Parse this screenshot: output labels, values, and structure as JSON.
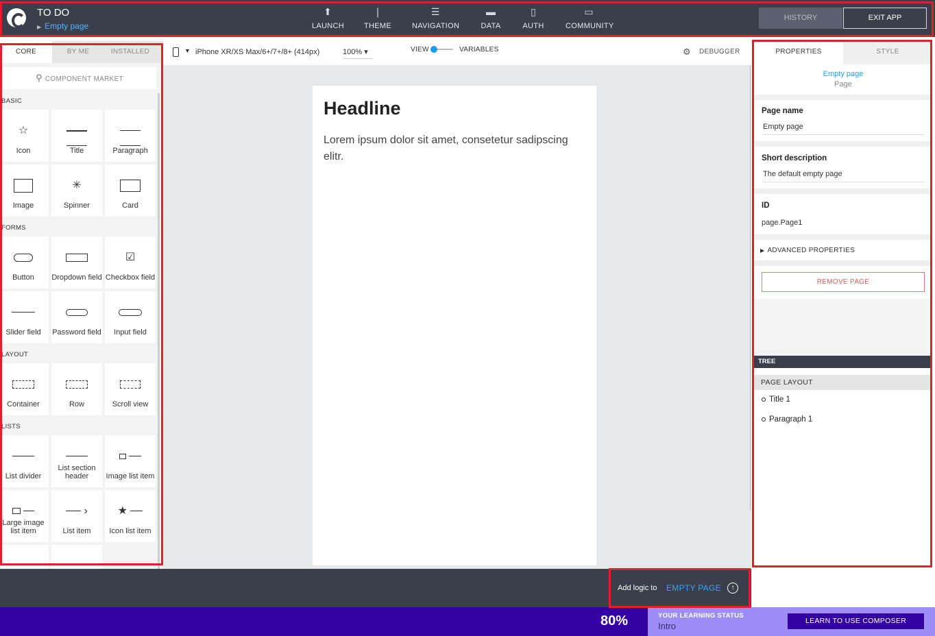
{
  "header": {
    "app_title": "TO DO",
    "page_crumb": "Empty page",
    "nav": [
      {
        "label": "LAUNCH",
        "icon": "upload-circle-icon"
      },
      {
        "label": "THEME",
        "icon": "brush-icon"
      },
      {
        "label": "NAVIGATION",
        "icon": "list-icon"
      },
      {
        "label": "DATA",
        "icon": "folder-icon"
      },
      {
        "label": "AUTH",
        "icon": "file-code-icon"
      },
      {
        "label": "COMMUNITY",
        "icon": "chat-icon"
      }
    ],
    "history_label": "HISTORY",
    "exit_label": "EXIT APP"
  },
  "left_panel": {
    "tabs": [
      "CORE",
      "BY ME",
      "INSTALLED"
    ],
    "active_tab": "CORE",
    "market_label": "COMPONENT MARKET",
    "sections": {
      "basic": "BASIC",
      "forms": "FORMS",
      "layout": "LAYOUT",
      "lists": "LISTS"
    },
    "components": {
      "icon": "Icon",
      "title": "Title",
      "paragraph": "Paragraph",
      "image": "Image",
      "spinner": "Spinner",
      "card": "Card",
      "button": "Button",
      "dropdown": "Dropdown field",
      "checkbox": "Checkbox field",
      "slider": "Slider field",
      "password": "Password field",
      "input": "Input field",
      "container": "Container",
      "row": "Row",
      "scroll_view": "Scroll view",
      "list_divider": "List divider",
      "list_section_header": "List section header",
      "image_list_item": "Image list item",
      "large_image_list_item": "Large image list item",
      "list_item": "List item",
      "icon_list_item": "Icon list item"
    }
  },
  "canvas": {
    "device": "iPhone XR/XS Max/6+/7+/8+ (414px)",
    "zoom": "100%",
    "view_label": "VIEW",
    "variables_label": "VARIABLES",
    "debugger_label": "DEBUGGER",
    "headline": "Headline",
    "paragraph": "Lorem ipsum dolor sit amet, consetetur sadipscing elitr."
  },
  "right_panel": {
    "tabs": [
      "PROPERTIES",
      "STYLE"
    ],
    "active_tab": "PROPERTIES",
    "selected_name": "Empty page",
    "selected_type": "Page",
    "page_name_label": "Page name",
    "page_name_value": "Empty page",
    "short_desc_label": "Short description",
    "short_desc_value": "The default empty page",
    "id_label": "ID",
    "id_value": "page.Page1",
    "advanced_label": "ADVANCED PROPERTIES",
    "remove_label": "REMOVE PAGE",
    "tree_header": "TREE",
    "tree_section": "PAGE LAYOUT",
    "tree_items": [
      "Title 1",
      "Paragraph 1"
    ]
  },
  "footer": {
    "logic_prefix": "Add logic to",
    "logic_page": "EMPTY PAGE",
    "progress_percent": "80%",
    "learning_title": "YOUR LEARNING STATUS",
    "learning_value": "Intro",
    "learn_button": "LEARN TO USE COMPOSER"
  },
  "colors": {
    "topbar": "#3b3f4c",
    "accent_blue": "#2a9df4",
    "status_purple": "#3401a3",
    "learn_lavender": "#9f8df7",
    "highlight_red": "#e0202c"
  }
}
